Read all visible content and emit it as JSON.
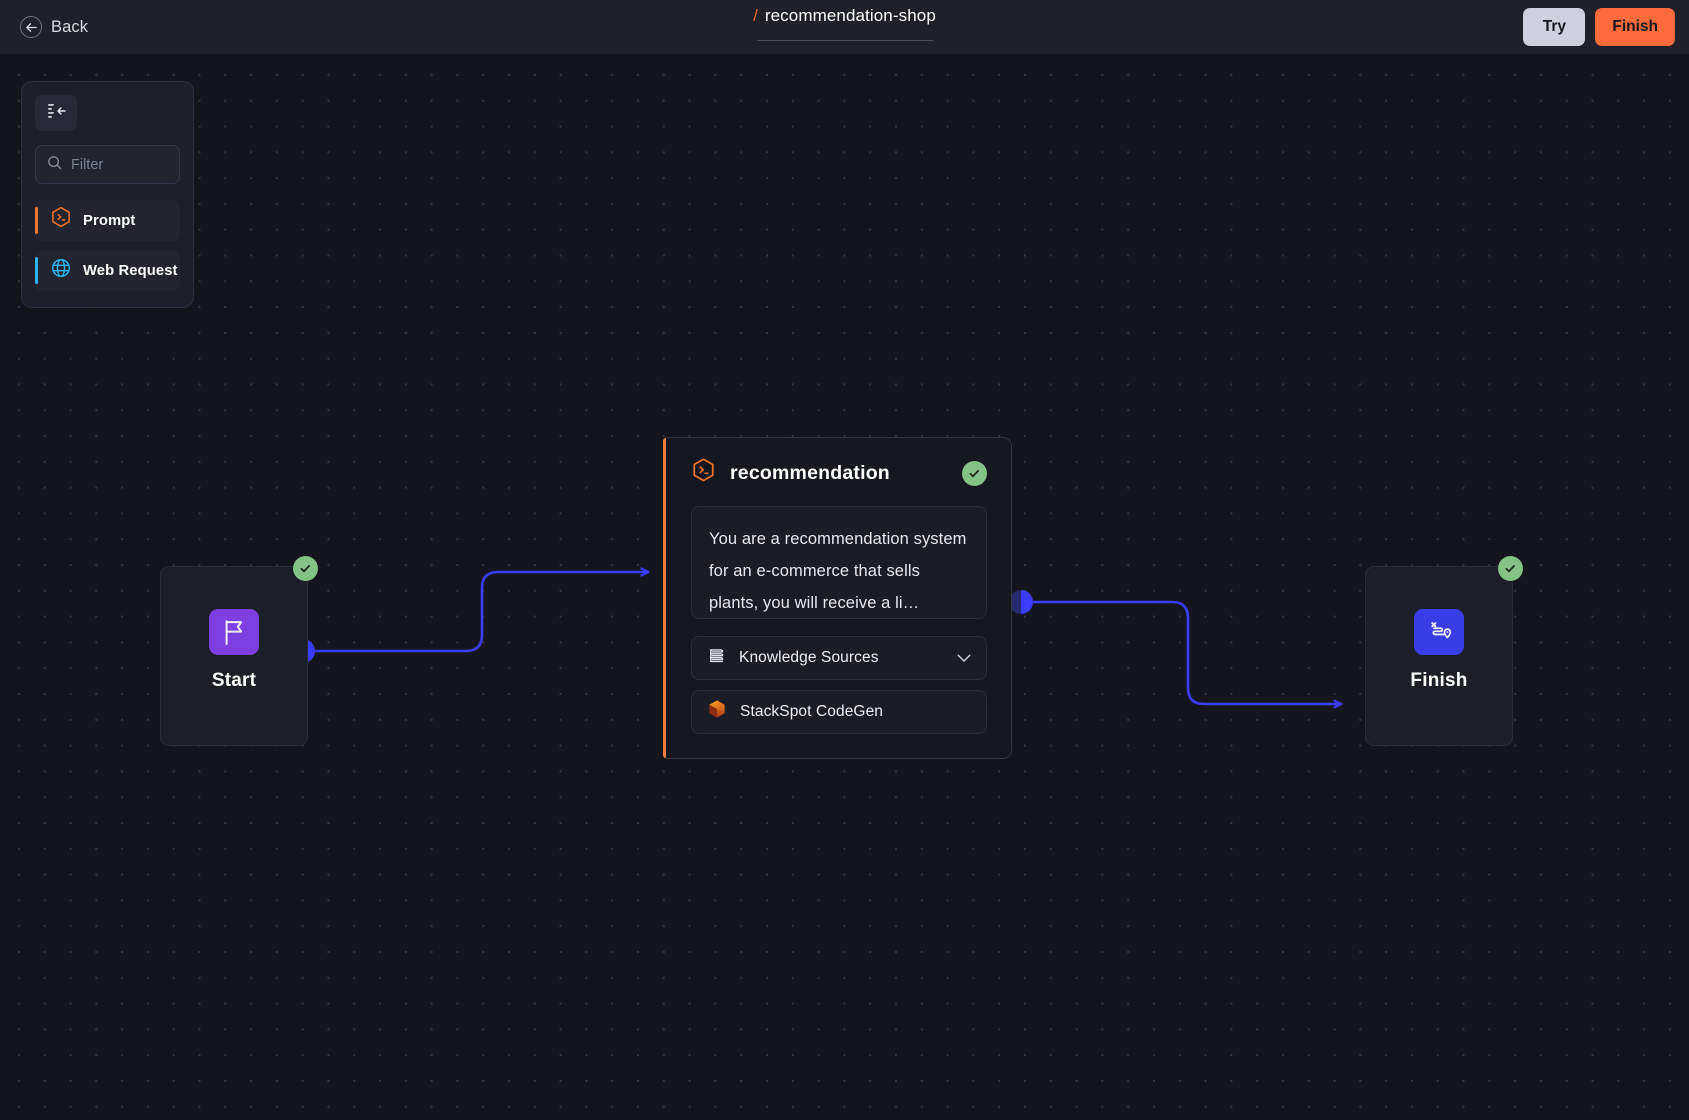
{
  "header": {
    "back_label": "Back",
    "back_icon": "arrow-left-icon",
    "title_prefix": "/",
    "title": "recommendation-shop",
    "try_label": "Try",
    "finish_label": "Finish",
    "accent_orange": "#fa6a3c",
    "try_bg": "#cfd0dd"
  },
  "palette": {
    "collapse_icon": "collapse-panel-icon",
    "filter": {
      "icon": "search-icon",
      "placeholder": "Filter",
      "value": ""
    },
    "items": [
      {
        "label": "Prompt",
        "icon": "hexagon-terminal-icon",
        "accent": "#f1762c"
      },
      {
        "label": "Web Request",
        "icon": "globe-icon",
        "accent": "#29b6f0"
      }
    ]
  },
  "canvas": {
    "nodes": {
      "start": {
        "label": "Start",
        "icon": "flag-icon",
        "icon_bg": "#7c3fe0",
        "status_icon": "check-circle-icon",
        "status_color": "#85c287"
      },
      "finish": {
        "label": "Finish",
        "icon": "route-map-icon",
        "icon_bg": "#3a3ce8",
        "status_icon": "check-circle-icon",
        "status_color": "#85c287"
      },
      "prompt": {
        "title": "recommendation",
        "icon": "hexagon-terminal-icon",
        "icon_color": "#f1762c",
        "accent_bar": "#e8803a",
        "status_icon": "check-circle-icon",
        "status_color": "#85c287",
        "prompt_text": "You are a recommendation system for an e-commerce that sells plants, you will receive a li…",
        "knowledge_sources": {
          "label": "Knowledge Sources",
          "icon": "books-stack-icon",
          "chevron": "chevron-down-icon"
        },
        "attached": [
          {
            "label": "StackSpot CodeGen",
            "icon": "cube-icon"
          }
        ]
      }
    },
    "edge_color": "#3b3bfb",
    "edges": [
      {
        "from": "start",
        "to": "prompt"
      },
      {
        "from": "prompt",
        "to": "finish"
      }
    ]
  }
}
